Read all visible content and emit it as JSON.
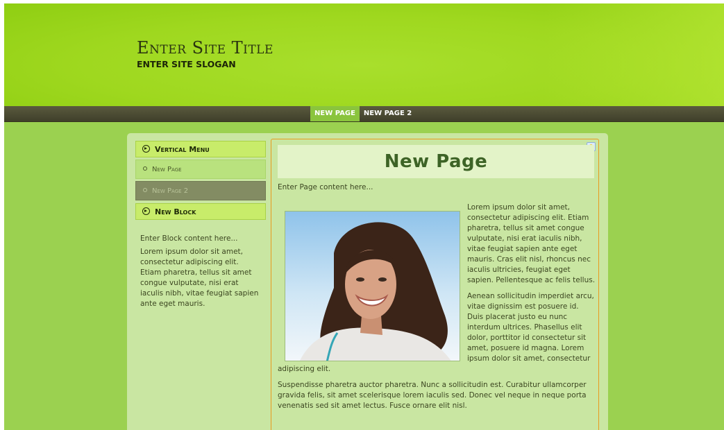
{
  "header": {
    "title": "Enter Site Title",
    "slogan": "ENTER SITE SLOGAN"
  },
  "nav": {
    "items": [
      {
        "label": "NEW PAGE",
        "active": true
      },
      {
        "label": "NEW PAGE 2",
        "active": false
      }
    ]
  },
  "sidebar": {
    "vertical_menu": {
      "title": "Vertical Menu",
      "items": [
        {
          "label": "New Page",
          "active": false
        },
        {
          "label": "New Page 2",
          "active": true
        }
      ]
    },
    "new_block": {
      "title": "New Block",
      "intro": "Enter Block content here...",
      "text": "Lorem ipsum dolor sit amet, consectetur adipiscing elit. Etiam pharetra, tellus sit amet congue vulputate, nisi erat iaculis nibh, vitae feugiat sapien ante eget mauris."
    }
  },
  "main": {
    "title": "New Page",
    "intro": "Enter Page content here...",
    "paragraph1": "Lorem ipsum dolor sit amet, consectetur adipiscing elit. Etiam pharetra, tellus sit amet congue vulputate, nisi erat iaculis nibh, vitae feugiat sapien ante eget mauris. Cras elit nisl, rhoncus nec iaculis ultricies, feugiat eget sapien. Pellentesque ac felis tellus.",
    "paragraph2": "Aenean sollicitudin imperdiet arcu, vitae dignissim est posuere id. Duis placerat justo eu nunc interdum ultrices. Phasellus elit dolor, porttitor id consectetur sit amet, posuere id magna. Lorem ipsum dolor sit amet, consectetur adipiscing elit.",
    "paragraph3": "Suspendisse pharetra auctor pharetra. Nunc a sollicitudin est. Curabitur ullamcorper gravida felis, sit amet scelerisque lorem iaculis sed. Donec vel neque in neque porta venenatis sed sit amet lectus. Fusce ornare elit nisl."
  },
  "colors": {
    "header_bg": "#9fd81f",
    "page_bg": "#9bd150",
    "nav_bg": "#4a4a33",
    "nav_active": "#8ac43d",
    "content_bg": "#c9e6a2",
    "title_color": "#3d6326",
    "border_accent": "#e89a1e"
  }
}
